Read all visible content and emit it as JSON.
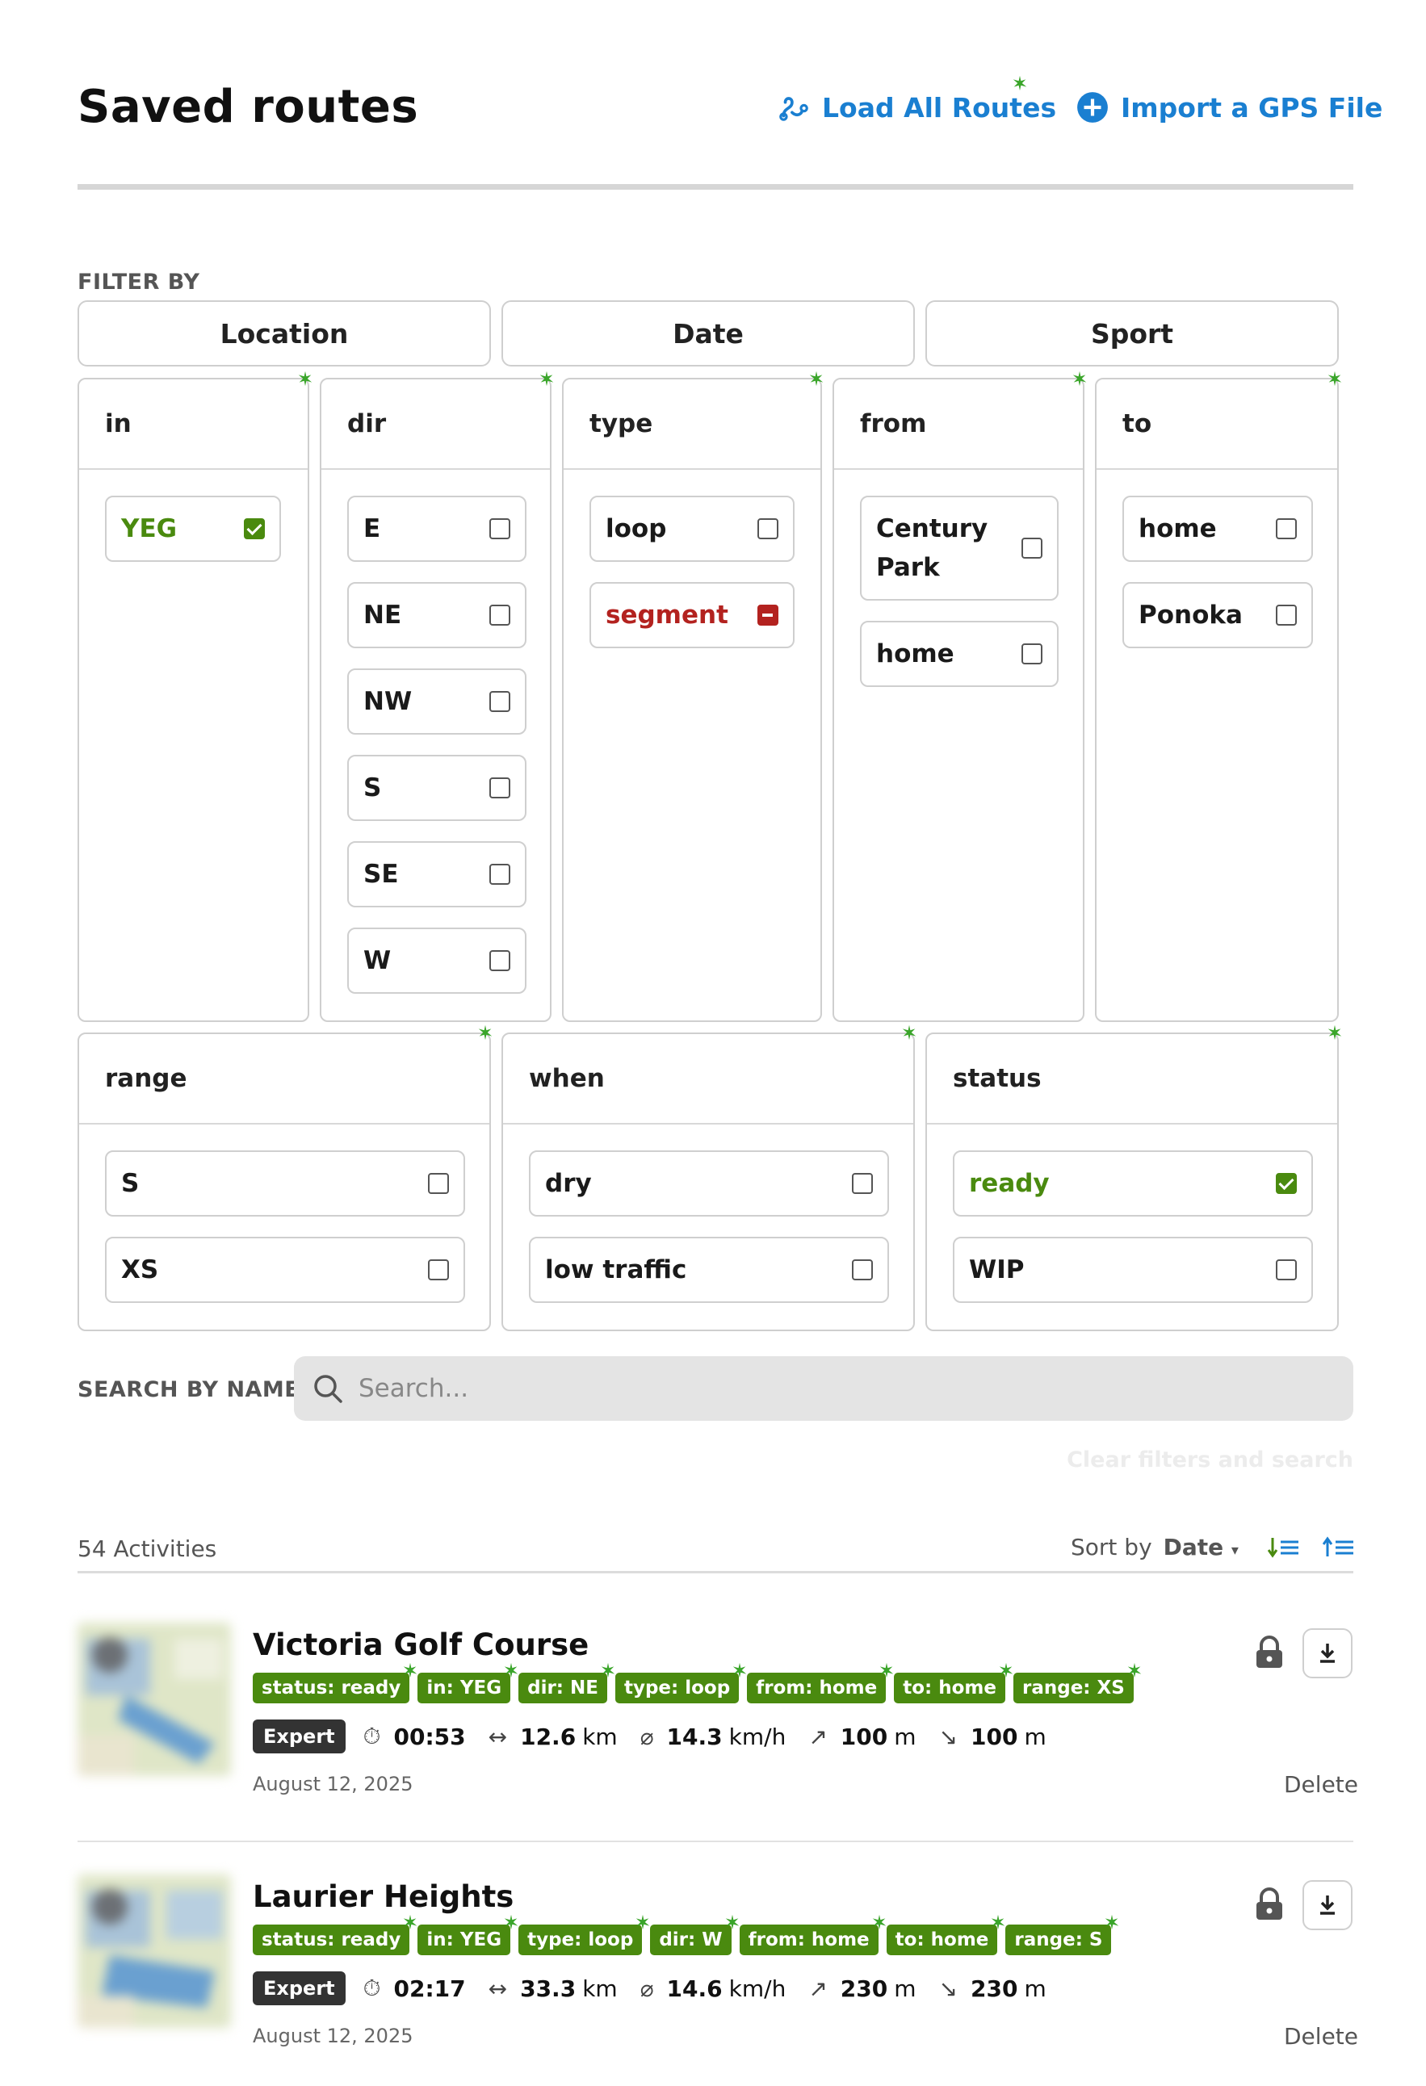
{
  "header": {
    "title": "Saved routes",
    "load_all_label": "Load All Routes",
    "import_label": "Import a GPS File"
  },
  "filter": {
    "label": "FILTER BY",
    "tabs": [
      "Location",
      "Date",
      "Sport"
    ],
    "groups": [
      {
        "title": "in",
        "options": [
          {
            "label": "YEG",
            "state": "checked"
          }
        ]
      },
      {
        "title": "dir",
        "options": [
          {
            "label": "E",
            "state": "unchecked"
          },
          {
            "label": "NE",
            "state": "unchecked"
          },
          {
            "label": "NW",
            "state": "unchecked"
          },
          {
            "label": "S",
            "state": "unchecked"
          },
          {
            "label": "SE",
            "state": "unchecked"
          },
          {
            "label": "W",
            "state": "unchecked"
          }
        ]
      },
      {
        "title": "type",
        "options": [
          {
            "label": "loop",
            "state": "unchecked"
          },
          {
            "label": "segment",
            "state": "excluded"
          }
        ]
      },
      {
        "title": "from",
        "options": [
          {
            "label": "Century Park",
            "state": "unchecked"
          },
          {
            "label": "home",
            "state": "unchecked"
          }
        ]
      },
      {
        "title": "to",
        "options": [
          {
            "label": "home",
            "state": "unchecked"
          },
          {
            "label": "Ponoka",
            "state": "unchecked"
          }
        ]
      },
      {
        "title": "range",
        "options": [
          {
            "label": "S",
            "state": "unchecked"
          },
          {
            "label": "XS",
            "state": "unchecked"
          }
        ]
      },
      {
        "title": "when",
        "options": [
          {
            "label": "dry",
            "state": "unchecked"
          },
          {
            "label": "low traffic",
            "state": "unchecked"
          }
        ]
      },
      {
        "title": "status",
        "options": [
          {
            "label": "ready",
            "state": "checked"
          },
          {
            "label": "WIP",
            "state": "unchecked"
          }
        ]
      }
    ]
  },
  "search": {
    "label": "SEARCH BY NAME",
    "placeholder": "Search...",
    "clear_label": "Clear filters and search"
  },
  "list": {
    "count_label": "54 Activities",
    "sort_label": "Sort by",
    "sort_value": "Date"
  },
  "activities": [
    {
      "title": "Victoria Golf Course",
      "tags": [
        "status: ready",
        "in: YEG",
        "dir: NE",
        "type: loop",
        "from: home",
        "to: home",
        "range: XS"
      ],
      "level": "Expert",
      "duration": "00:53",
      "distance": "12.6",
      "distance_unit": "km",
      "speed": "14.3",
      "speed_unit": "km/h",
      "ascent": "100",
      "ascent_unit": "m",
      "descent": "100",
      "descent_unit": "m",
      "date": "August 12, 2025",
      "delete_label": "Delete"
    },
    {
      "title": "Laurier Heights",
      "tags": [
        "status: ready",
        "in: YEG",
        "type: loop",
        "dir: W",
        "from: home",
        "to: home",
        "range: S"
      ],
      "level": "Expert",
      "duration": "02:17",
      "distance": "33.3",
      "distance_unit": "km",
      "speed": "14.6",
      "speed_unit": "km/h",
      "ascent": "230",
      "ascent_unit": "m",
      "descent": "230",
      "descent_unit": "m",
      "date": "August 12, 2025",
      "delete_label": "Delete"
    }
  ],
  "colors": {
    "accent_blue": "#1a7fd1",
    "tag_green": "#4a8a0f",
    "excluded_red": "#b3221f",
    "sparkle_green": "#3aa52a"
  }
}
